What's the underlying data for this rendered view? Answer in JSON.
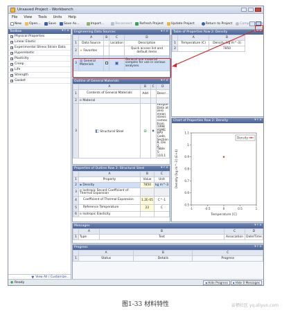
{
  "window": {
    "title": "Unsaved Project - Workbench"
  },
  "menu": [
    "File",
    "View",
    "Tools",
    "Units",
    "Help"
  ],
  "toolbar": {
    "new": "New",
    "open": "Open...",
    "save": "Save",
    "save_as": "Save As...",
    "import": "Import...",
    "reconnect": "Reconnect",
    "refresh": "Refresh Project",
    "update": "Update Project",
    "return": "Return to Project",
    "compact": "Compact Mode"
  },
  "toolbox": {
    "title": "Toolbox",
    "items": [
      "Physical Properties",
      "Linear Elastic",
      "Experimental Stress Strain Data",
      "Hyperelastic",
      "Plasticity",
      "Creep",
      "Life",
      "Strength",
      "Gasket"
    ],
    "footer": "View All / Customize..."
  },
  "data_sources": {
    "title": "Engineering Data Sources",
    "headers": [
      "",
      "A",
      "B",
      "C",
      "D"
    ],
    "header_row": {
      "a": "Data Source",
      "c": "Location",
      "d": "Description"
    },
    "rows": [
      {
        "num": "2",
        "name": "Favorites",
        "desc": "Quick access list and default items"
      },
      {
        "num": "3",
        "name": "General Materials",
        "desc": "General use material samples for use in various analyses."
      }
    ]
  },
  "outline_general": {
    "title": "Outline of General Materials",
    "headers": [
      "",
      "A",
      "B",
      "C",
      "D"
    ],
    "header_row": {
      "a": "Contents of General Materials",
      "b": "Add",
      "d": "Descr..."
    },
    "rows": [
      {
        "num": "2",
        "name": "Material"
      },
      {
        "num": "3",
        "name": "Structural Steel",
        "desc": "Fatigue Data at zero mean stress comes from 1998 ASME BPV Code, Section 8, Div 2, Table 5-110.1"
      }
    ]
  },
  "properties_outline": {
    "title": "Properties of Outline Row 3: Structural Steel",
    "headers": [
      "",
      "A",
      "B",
      "C"
    ],
    "header_row": {
      "a": "Property",
      "b": "Value",
      "c": "Unit"
    },
    "rows": [
      {
        "num": "2",
        "prop": "Density",
        "value": "7850",
        "unit": "kg m^-3"
      },
      {
        "num": "3",
        "prop": "Isotropic Secant Coefficient of Thermal Expansion",
        "value": "",
        "unit": ""
      },
      {
        "num": "4",
        "prop": "Coefficient of Thermal Expansion",
        "value": "1.2E-05",
        "unit": "C^-1"
      },
      {
        "num": "5",
        "prop": "Reference Temperature",
        "value": "22",
        "unit": "C"
      },
      {
        "num": "6",
        "prop": "Isotropic Elasticity",
        "value": "",
        "unit": ""
      }
    ]
  },
  "table_props": {
    "title": "Table of Properties Row 2: Density",
    "headers": [
      "",
      "A",
      "B"
    ],
    "rows": [
      {
        "num": "1",
        "a": "Temperature (C)",
        "b": "Density (kg m^-3)"
      },
      {
        "num": "2",
        "a": "",
        "b": "7850"
      }
    ]
  },
  "chart_panel": {
    "title": "Chart of Properties Row 2: Density"
  },
  "chart_data": {
    "type": "scatter",
    "series": [
      {
        "name": "Density",
        "x": [
          0
        ],
        "y": [
          0.9
        ],
        "color": "#d22a2a"
      }
    ],
    "xlabel": "Temperature [C]",
    "ylabel": "Density [kg m^-3] (E+4)",
    "xlim": [
      -1,
      1
    ],
    "ylim": [
      0.5,
      1.1
    ],
    "xticks": [
      "-1",
      "-0.5",
      "0",
      "0.5",
      "1"
    ],
    "yticks": [
      "1.1",
      "1",
      "0.9",
      "0.8",
      "0.7",
      "0.6",
      "0.5"
    ],
    "legend": "top-right",
    "grid": false
  },
  "messages": {
    "title": "Messages",
    "headers": [
      "",
      "A",
      "B",
      "C",
      "D"
    ],
    "header_row": {
      "a": "Type",
      "b": "Text",
      "c": "Association",
      "d": "Date/Time"
    }
  },
  "progress": {
    "title": "Progress",
    "headers": [
      "",
      "A",
      "B",
      "C"
    ],
    "header_row": {
      "a": "Status",
      "b": "Details",
      "c": "Progress"
    }
  },
  "statusbar": {
    "text": "Ready",
    "hide_progress": "Hide Progress",
    "hide_messages": "Hide 0 Messages"
  },
  "caption": "图1-33 材料特性",
  "watermark": "云栖社区 yq.aliyun.com",
  "colors": {
    "panel_header": "#5670a4",
    "highlight": "#d22a2a",
    "selection": "#cfe0f6"
  }
}
